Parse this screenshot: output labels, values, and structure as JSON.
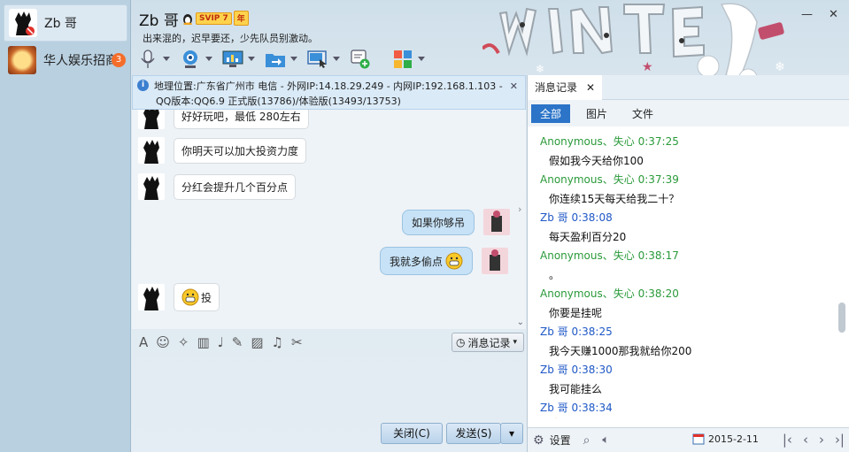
{
  "sidebar": {
    "contacts": [
      {
        "name": "Zb 哥"
      },
      {
        "name": "华人娱乐招商",
        "badge": "3"
      }
    ]
  },
  "header": {
    "title": "Zb 哥",
    "vip_label": "SVIP 7",
    "vip_year": "年",
    "signature": "出来混的，迟早要还，少先队员别激动。"
  },
  "window_controls": {
    "minimize": "—",
    "close": "✕"
  },
  "info_bar": {
    "line1": "地理位置:广东省广州市 电信 - 外网IP:14.18.29.249 - 内网IP:192.168.1.103 -",
    "line2": "QQ版本:QQ6.9 正式版(13786)/体验版(13493/13753)",
    "close": "✕"
  },
  "chat": {
    "messages": [
      {
        "side": "left",
        "text": "好好玩吧，最低 280左右"
      },
      {
        "side": "left",
        "text": "你明天可以加大投资力度"
      },
      {
        "side": "left",
        "text": "分红会提升几个百分点"
      },
      {
        "side": "right",
        "text": "如果你够吊"
      },
      {
        "side": "right",
        "text": "我就多偷点"
      },
      {
        "side": "left",
        "text": "投"
      }
    ]
  },
  "input_toolbar": {
    "history_label": "消息记录"
  },
  "buttons": {
    "close": "关闭(C)",
    "send": "发送(S)"
  },
  "history_panel": {
    "tab_label": "消息记录",
    "tab_close": "✕",
    "filters": [
      "全部",
      "图片",
      "文件"
    ],
    "entries": [
      {
        "sender": "Anonymous、失心",
        "time": "0:37:25",
        "color": "green",
        "text": "假如我今天给你100"
      },
      {
        "sender": "Anonymous、失心",
        "time": "0:37:39",
        "color": "green",
        "text": "你连续15天每天给我二十？"
      },
      {
        "sender": "Zb 哥",
        "time": "0:38:08",
        "color": "blue",
        "text": "每天盈利百分20"
      },
      {
        "sender": "Anonymous、失心",
        "time": "0:38:17",
        "color": "green",
        "text": "。"
      },
      {
        "sender": "Anonymous、失心",
        "time": "0:38:20",
        "color": "green",
        "text": "你要是挂呢"
      },
      {
        "sender": "Zb 哥",
        "time": "0:38:25",
        "color": "blue",
        "text": "我今天赚1000那我就给你200"
      },
      {
        "sender": "Zb 哥",
        "time": "0:38:30",
        "color": "blue",
        "text": "我可能挂么"
      },
      {
        "sender": "Zb 哥",
        "time": "0:38:34",
        "color": "blue",
        "text": ""
      }
    ],
    "settings_label": "设置",
    "date": "2015-2-11"
  },
  "colors": {
    "accent": "#2b74c8",
    "green_sender": "#2a9a3a",
    "blue_sender": "#1f58c6"
  }
}
